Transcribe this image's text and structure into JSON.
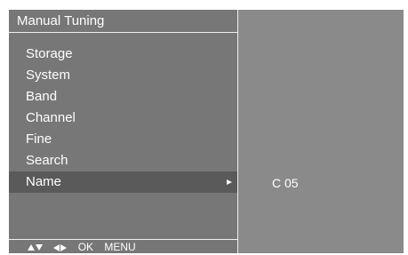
{
  "menu": {
    "title": "Manual  Tuning",
    "items": [
      {
        "label": "Storage"
      },
      {
        "label": "System"
      },
      {
        "label": "Band"
      },
      {
        "label": "Channel"
      },
      {
        "label": "Fine"
      },
      {
        "label": "Search"
      },
      {
        "label": "Name",
        "selected": true
      }
    ],
    "footer": {
      "ok_label": "OK",
      "menu_label": "MENU"
    }
  },
  "value_panel": {
    "channel_value": "C 05"
  },
  "colors": {
    "menu_background": "#777777",
    "value_background": "#8a8a8a",
    "selected_row": "#5a5a5a",
    "text": "#ffffff"
  }
}
